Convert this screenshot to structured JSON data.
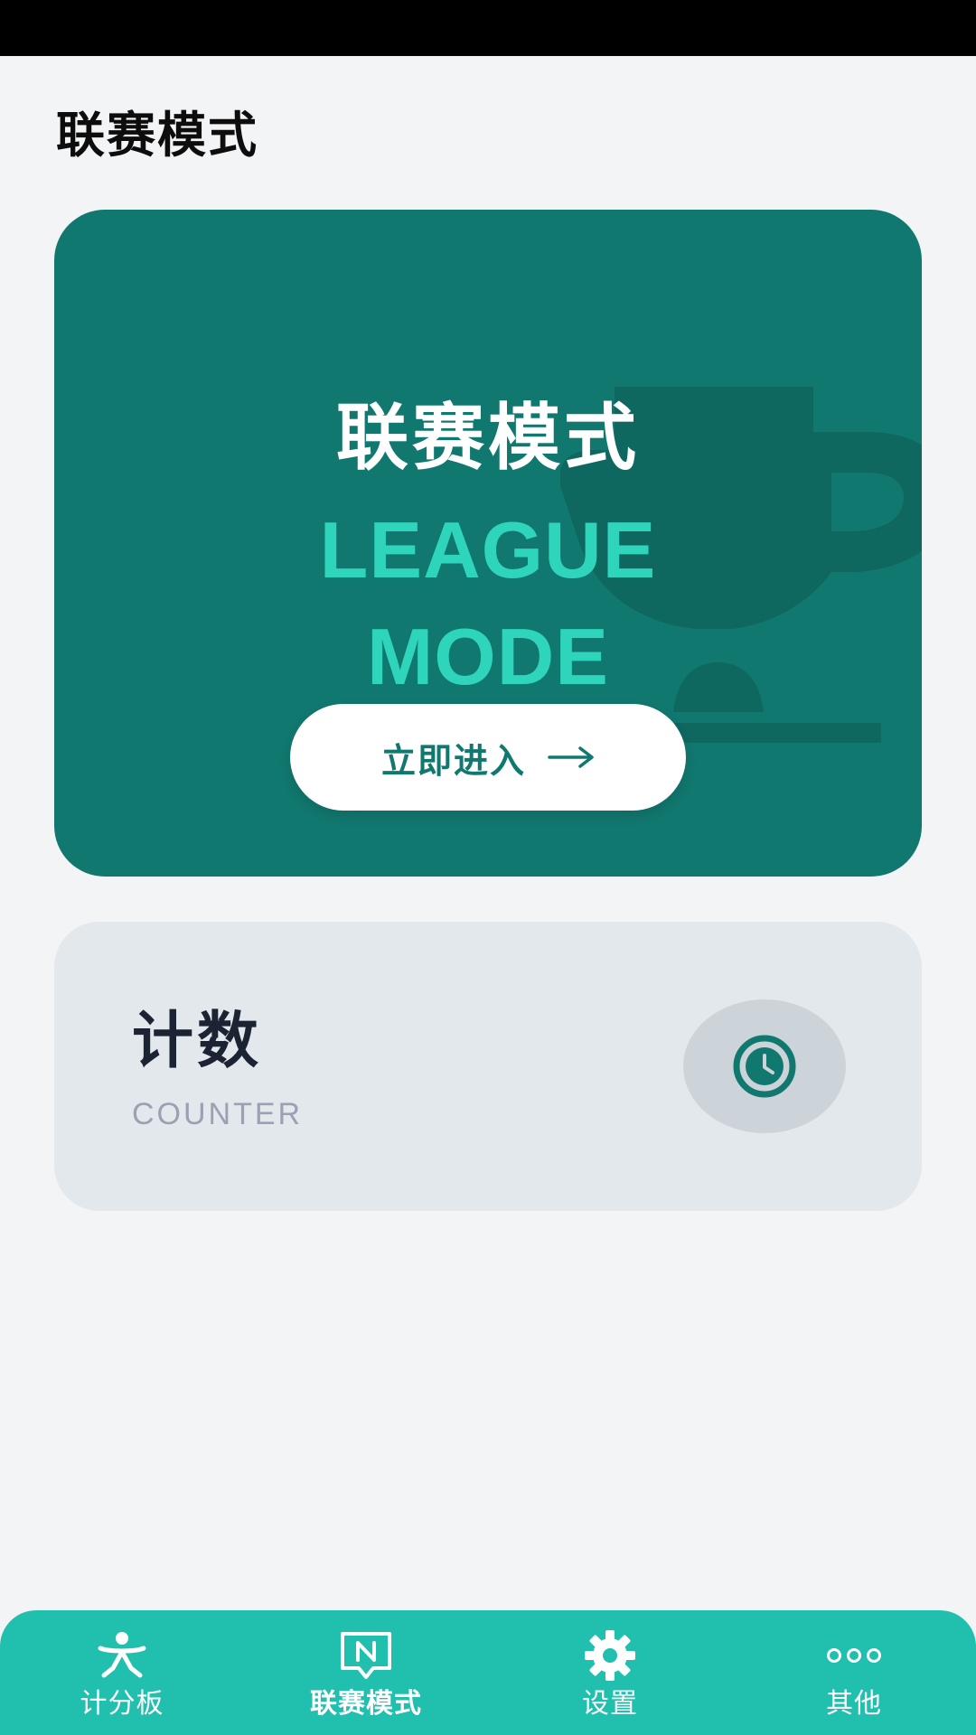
{
  "page": {
    "title": "联赛模式"
  },
  "league_card": {
    "title": "联赛模式",
    "subtitle_line1": "LEAGUE",
    "subtitle_line2": "MODE",
    "button_label": "立即进入",
    "icon": "trophy-icon",
    "button_icon": "arrow-right-icon"
  },
  "counter_card": {
    "title": "计数",
    "subtitle": "COUNTER",
    "icon": "clock-icon"
  },
  "bottom_nav": {
    "items": [
      {
        "label": "计分板",
        "icon": "person-icon",
        "active": false
      },
      {
        "label": "联赛模式",
        "icon": "league-badge-icon",
        "active": true
      },
      {
        "label": "设置",
        "icon": "gear-icon",
        "active": false
      },
      {
        "label": "其他",
        "icon": "more-dots-icon",
        "active": false
      }
    ]
  },
  "colors": {
    "primary": "#11786f",
    "accent": "#2ed5bb",
    "nav": "#21bfad",
    "background": "#f3f4f5",
    "counter_card": "#e3e8ec"
  }
}
